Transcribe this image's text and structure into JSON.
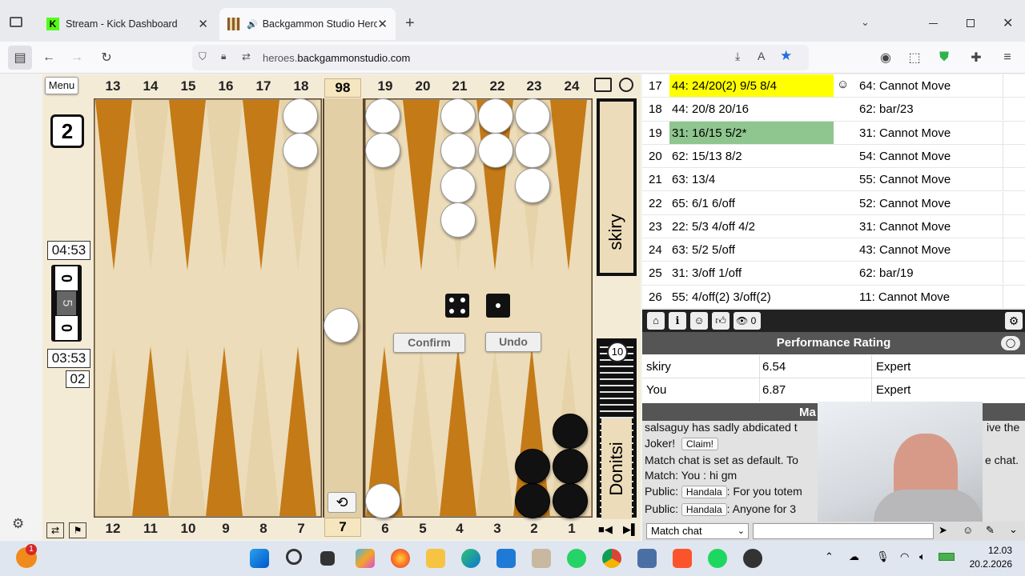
{
  "browser": {
    "tabs": [
      {
        "title": "Stream - Kick Dashboard"
      },
      {
        "title": "Backgammon Studio Heroes"
      }
    ],
    "url_host_prefix": "heroes.",
    "url_host_main": "backgammonstudio.com"
  },
  "board": {
    "menu_label": "Menu",
    "top_numbers": [
      "13",
      "14",
      "15",
      "16",
      "17",
      "18",
      "19",
      "20",
      "21",
      "22",
      "23",
      "24"
    ],
    "bottom_numbers": [
      "12",
      "11",
      "10",
      "9",
      "8",
      "7",
      "6",
      "5",
      "4",
      "3",
      "2",
      "1"
    ],
    "top_pip": "98",
    "bottom_pip": "7",
    "cube_value": "2",
    "match_length": "5",
    "score_top": "0",
    "score_bottom": "0",
    "clock_top": "04:53",
    "clock_bottom": "03:53",
    "delay": "02",
    "opponent_name": "skiry",
    "player_name": "Donitsi",
    "off_count": "10",
    "confirm_label": "Confirm",
    "undo_label": "Undo",
    "dice": [
      4,
      1
    ]
  },
  "moves": [
    {
      "n": "17",
      "a": "44: 24/20(2) 9/5 8/4",
      "b": "64: Cannot Move",
      "hl": "yellow"
    },
    {
      "n": "18",
      "a": "44: 20/8 20/16",
      "b": "62: bar/23",
      "hl": ""
    },
    {
      "n": "19",
      "a": "31: 16/15 5/2*",
      "b": "31: Cannot Move",
      "hl": "green"
    },
    {
      "n": "20",
      "a": "62: 15/13 8/2",
      "b": "54: Cannot Move",
      "hl": ""
    },
    {
      "n": "21",
      "a": "63: 13/4",
      "b": "55: Cannot Move",
      "hl": ""
    },
    {
      "n": "22",
      "a": "65: 6/1 6/off",
      "b": "52: Cannot Move",
      "hl": ""
    },
    {
      "n": "23",
      "a": "22: 5/3 4/off 4/2",
      "b": "31: Cannot Move",
      "hl": ""
    },
    {
      "n": "24",
      "a": "63: 5/2 5/off",
      "b": "43: Cannot Move",
      "hl": ""
    },
    {
      "n": "25",
      "a": "31: 3/off 1/off",
      "b": "62: bar/19",
      "hl": ""
    },
    {
      "n": "26",
      "a": "55: 4/off(2) 3/off(2)",
      "b": "11: Cannot Move",
      "hl": ""
    }
  ],
  "viewer_count": "0",
  "performance": {
    "title": "Performance Rating",
    "rows": [
      {
        "name": "skiry",
        "rating": "6.54",
        "level": "Expert"
      },
      {
        "name": "You",
        "rating": "6.87",
        "level": "Expert"
      }
    ]
  },
  "chat": {
    "header_fragment": "Ma",
    "line1": "salsaguy has sadly abdicated t",
    "line1_end": "ive the",
    "line2": "Joker!",
    "claim_label": "Claim!",
    "line3": "Match chat is set as default. To",
    "line3_end": "e chat.",
    "line4": "Match: You : hi gm",
    "line5_prefix": "Public:",
    "line5_user": "Handala",
    "line5_text": ": For you totem",
    "line6_prefix": "Public:",
    "line6_user": "Handala",
    "line6_text": ": Anyone for 3",
    "channel": "Match chat"
  },
  "taskbar": {
    "time": "12.03",
    "date": "20.2.2026",
    "badge": "1"
  }
}
